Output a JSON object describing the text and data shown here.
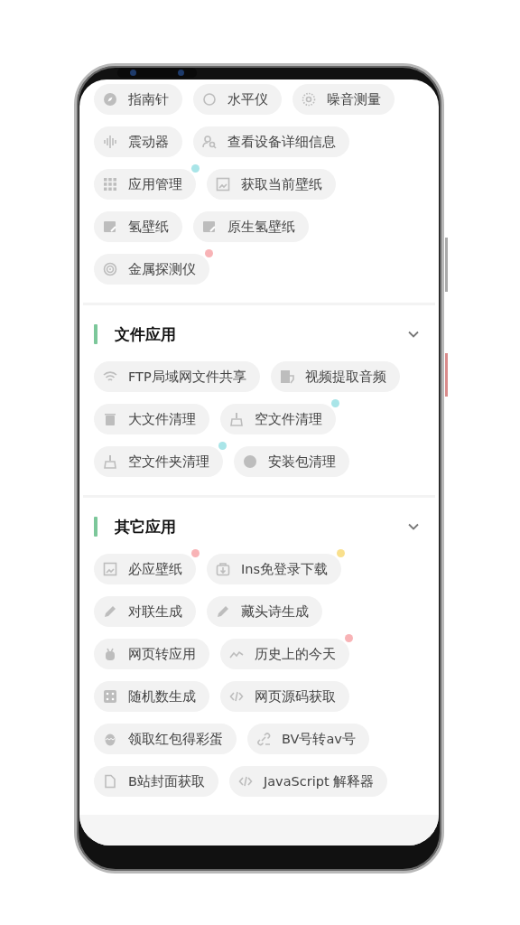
{
  "sections": [
    {
      "rows": [
        [
          {
            "label": "指南针"
          },
          {
            "label": "水平仪"
          },
          {
            "label": "噪音测量"
          }
        ],
        [
          {
            "label": "震动器"
          },
          {
            "label": "查看设备详细信息"
          }
        ],
        [
          {
            "label": "应用管理",
            "color": "#a9e5e8"
          },
          {
            "label": "获取当前壁纸"
          }
        ],
        [
          {
            "label": "氢壁纸"
          },
          {
            "label": "原生氢壁纸"
          }
        ],
        [
          {
            "label": "金属探测仪",
            "color": "#f8b3b6"
          }
        ]
      ]
    },
    {
      "title": "文件应用",
      "expanded": true,
      "rows": [
        [
          {
            "label": "FTP局域网文件共享"
          },
          {
            "label": "视频提取音频"
          }
        ],
        [
          {
            "label": "大文件清理"
          },
          {
            "label": "空文件清理",
            "color": "#a9e5e8"
          }
        ],
        [
          {
            "label": "空文件夹清理",
            "color": "#a9e5e8"
          },
          {
            "label": "安装包清理"
          }
        ]
      ]
    },
    {
      "title": "其它应用",
      "expanded": true,
      "rows": [
        [
          {
            "label": "必应壁纸",
            "color": "#f8b3b6"
          },
          {
            "label": "Ins免登录下载",
            "color": "#f9e08d"
          }
        ],
        [
          {
            "label": "对联生成"
          },
          {
            "label": "藏头诗生成"
          }
        ],
        [
          {
            "label": "网页转应用"
          },
          {
            "label": "历史上的今天",
            "color": "#f8b3b6"
          }
        ],
        [
          {
            "label": "随机数生成"
          },
          {
            "label": "网页源码获取"
          }
        ],
        [
          {
            "label": "领取红包得彩蛋"
          },
          {
            "label": "BV号转av号"
          }
        ],
        [
          {
            "label": "B站封面获取"
          },
          {
            "label": "JavaScript 解释器"
          }
        ]
      ]
    }
  ]
}
